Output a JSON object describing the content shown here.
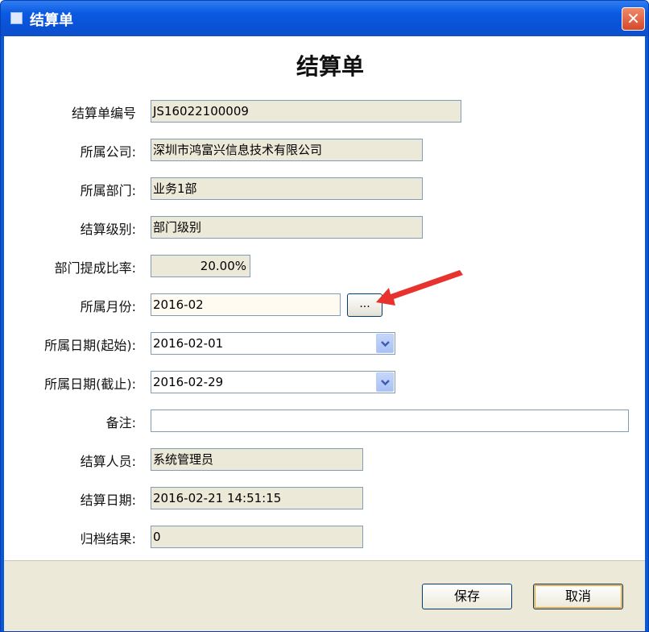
{
  "window": {
    "title": "结算单",
    "close_glyph": "✕"
  },
  "form": {
    "heading": "结算单",
    "fields": [
      {
        "label": "结算单编号",
        "value": "JS16022100009"
      },
      {
        "label": "所属公司:",
        "value": "深圳市鸿富兴信息技术有限公司"
      },
      {
        "label": "所属部门:",
        "value": "业务1部"
      },
      {
        "label": "结算级别:",
        "value": "部门级别"
      },
      {
        "label": "部门提成比率:",
        "value": "20.00%"
      },
      {
        "label": "所属月份:",
        "value": "2016-02",
        "button": "..."
      },
      {
        "label": "所属日期(起始):",
        "value": "2016-02-01"
      },
      {
        "label": "所属日期(截止):",
        "value": "2016-02-29"
      },
      {
        "label": "备注:",
        "value": ""
      },
      {
        "label": "结算人员:",
        "value": "系统管理员"
      },
      {
        "label": "结算日期:",
        "value": "2016-02-21 14:51:15"
      },
      {
        "label": "归档结果:",
        "value": "0"
      }
    ]
  },
  "buttons": {
    "save": "保存",
    "cancel": "取消"
  },
  "colors": {
    "titlebar": "#0a58d8",
    "readonly_field": "#ece9d8",
    "arrow": "#e8322d",
    "footer": "#ece9d8"
  },
  "icons": {
    "dropdown": "chevron-down-icon",
    "close": "close-icon",
    "annotation": "red-arrow"
  }
}
